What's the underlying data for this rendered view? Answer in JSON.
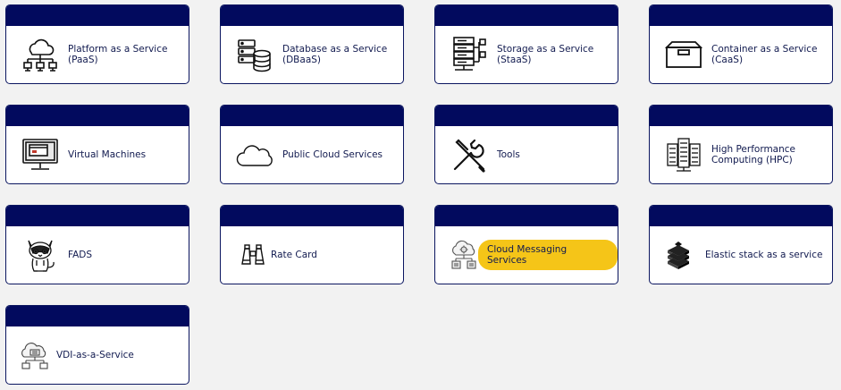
{
  "cards": [
    {
      "label": "Platform as a Service (PaaS)",
      "icon": "cloud-network-icon"
    },
    {
      "label": "Database as a Service (DBaaS)",
      "icon": "database-icon"
    },
    {
      "label": "Storage as a Service (StaaS)",
      "icon": "storage-server-icon"
    },
    {
      "label": "Container as a Service (CaaS)",
      "icon": "container-box-icon"
    },
    {
      "label": "Virtual Machines",
      "icon": "virtual-machine-monitor-icon"
    },
    {
      "label": "Public Cloud Services",
      "icon": "cloud-icon"
    },
    {
      "label": "Tools",
      "icon": "tools-icon"
    },
    {
      "label": "High Performance Computing (HPC)",
      "icon": "server-rack-icon"
    },
    {
      "label": "FADS",
      "icon": "cat-mascot-icon"
    },
    {
      "label": "Rate Card",
      "icon": "binoculars-icon"
    },
    {
      "label": "Cloud Messaging Services",
      "icon": "cloud-messaging-icon",
      "highlighted": true
    },
    {
      "label": "Elastic stack as a service",
      "icon": "elastic-stack-icon"
    },
    {
      "label": "VDI-as-a-Service",
      "icon": "cloud-desktop-icon"
    }
  ],
  "colors": {
    "header": "#020a5e",
    "border": "#0b1660",
    "text": "#111a4f",
    "highlight": "#f5c518",
    "background": "#f2f2f2"
  }
}
